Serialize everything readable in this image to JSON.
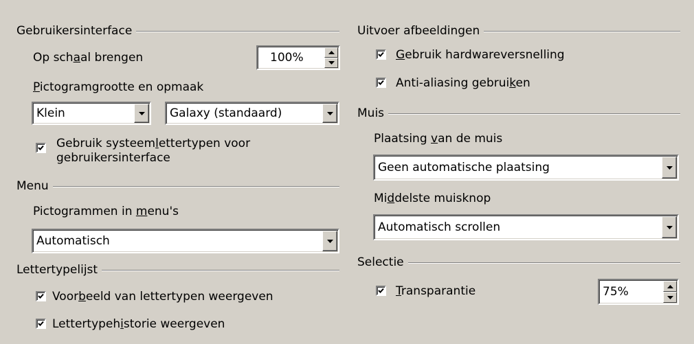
{
  "left": {
    "ui": {
      "title": "Gebruikersinterface",
      "scale_label_pre": "Op sch",
      "scale_label_key": "a",
      "scale_label_post": "al brengen",
      "scale_value": "100%",
      "icon_label_key": "P",
      "icon_label_post": "ictogramgrootte en opmaak",
      "icon_size_value": "Klein",
      "icon_style_value": "Galaxy (standaard)",
      "sysfont_line1_pre": "Gebruik systeem",
      "sysfont_line1_key": "l",
      "sysfont_line1_post": "ettertypen voor",
      "sysfont_line2": "gebruikersinterface",
      "sysfont_checked": true
    },
    "menu": {
      "title": "Menu",
      "icons_label_pre": "Pictogrammen in ",
      "icons_label_key": "m",
      "icons_label_post": "enu's",
      "icons_value": "Automatisch"
    },
    "fontlist": {
      "title": "Lettertypelijst",
      "preview_pre": "Voor",
      "preview_key": "b",
      "preview_post": "eeld van lettertypen weergeven",
      "preview_checked": true,
      "history_pre": "Lettertypeh",
      "history_key": "i",
      "history_post": "storie weergeven",
      "history_checked": true
    }
  },
  "right": {
    "output": {
      "title": "Uitvoer afbeeldingen",
      "hw_key": "G",
      "hw_post": "ebruik hardwareversnelling",
      "hw_checked": true,
      "aa_pre": "Anti-aliasing gebrui",
      "aa_key": "k",
      "aa_post": "en",
      "aa_checked": true
    },
    "mouse": {
      "title": "Muis",
      "placement_pre": "Plaatsing ",
      "placement_key": "v",
      "placement_post": "an de muis",
      "placement_value": "Geen automatische plaatsing",
      "middle_pre": "Mi",
      "middle_key": "d",
      "middle_post": "delste muisknop",
      "middle_value": "Automatisch scrollen"
    },
    "selection": {
      "title": "Selectie",
      "trans_key": "T",
      "trans_post": "ransparantie",
      "trans_checked": true,
      "trans_value": "75%"
    }
  },
  "icons": {
    "checkmark": "check-icon",
    "dropdown": "triangle-down-icon",
    "spin_up": "triangle-up-icon",
    "spin_down": "triangle-down-icon"
  },
  "colors": {
    "face": "#d4d0c8",
    "shadow": "#808080",
    "field": "#ffffff"
  }
}
